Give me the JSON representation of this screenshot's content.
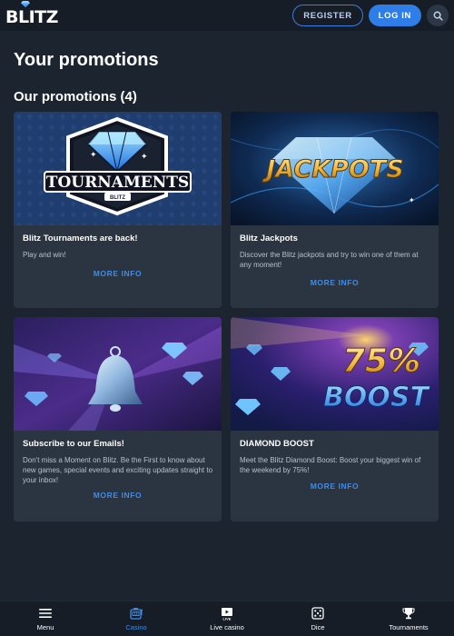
{
  "header": {
    "logo_text": "BLITZ",
    "register_label": "REGISTER",
    "login_label": "LOG IN",
    "search_icon": "search-icon"
  },
  "page_title": "Your promotions",
  "section_title": "Our promotions (4)",
  "promotions": [
    {
      "title": "Blitz Tournaments are back!",
      "description": "Play and win!",
      "more_label": "MORE INFO",
      "image_text_main": "TOURNAMENTS",
      "image_text_sub": "BLITZ"
    },
    {
      "title": "Blitz Jackpots",
      "description": "Discover the Blitz jackpots and try to win one of them at any moment!",
      "more_label": "MORE INFO",
      "image_text_main": "JACKPOTS"
    },
    {
      "title": "Subscribe to our Emails!",
      "description": "Don't miss a Moment on Blitz. Be the First to know about new games, special events and exciting updates straight to your inbox!",
      "more_label": "MORE INFO"
    },
    {
      "title": "DIAMOND BOOST",
      "description": "Meet the Blitz Diamond Boost: Boost your biggest win of the weekend by 75%!",
      "more_label": "MORE INFO",
      "image_text_main": "75%",
      "image_text_sub": "BOOST"
    }
  ],
  "bottom_nav": [
    {
      "label": "Menu",
      "icon": "menu-icon",
      "active": false
    },
    {
      "label": "Casino",
      "icon": "slot-machine-icon",
      "active": true
    },
    {
      "label": "Live casino",
      "icon": "live-tv-icon",
      "active": false
    },
    {
      "label": "Dice",
      "icon": "dice-icon",
      "active": false
    },
    {
      "label": "Tournaments",
      "icon": "trophy-icon",
      "active": false
    }
  ],
  "colors": {
    "background": "#1c2430",
    "header": "#161d27",
    "card": "#2b3441",
    "accent": "#3f8ce8"
  }
}
